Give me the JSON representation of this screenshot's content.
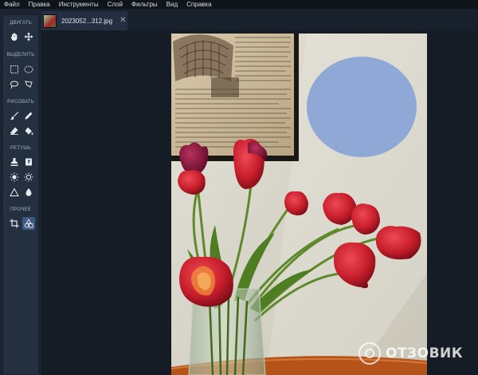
{
  "menu": {
    "items": [
      "Файл",
      "Правка",
      "Инструменты",
      "Слой",
      "Фильтры",
      "Вид",
      "Справка"
    ]
  },
  "tab": {
    "title": "2023052...312.jpg",
    "close": "✕"
  },
  "toolbar": {
    "sections": {
      "move": "ДВИГАТЬ",
      "select": "ВЫДЕЛИТЬ",
      "draw": "РИСОВАТЬ",
      "retouch": "РЕТУШЬ",
      "other": "ПРОЧЕЕ"
    },
    "tools": [
      "hand-icon",
      "move-arrows-icon",
      "rect-select-icon",
      "ellipse-select-icon",
      "lasso-icon",
      "polygon-lasso-icon",
      "brush-icon",
      "pencil-icon",
      "eraser-icon",
      "paint-bucket-icon",
      "stamp-icon",
      "healing-icon",
      "brightness-icon",
      "sun-icon",
      "sharpen-triangle-icon",
      "drop-icon",
      "crop-icon",
      "shapes-icon"
    ],
    "active_tool": "shapes-icon"
  },
  "watermark": {
    "text": "ОТЗОВИК"
  },
  "colors": {
    "accent": "#3d5a80",
    "ellipse": "#8fa8d6",
    "tulip": "#c81e2c"
  }
}
